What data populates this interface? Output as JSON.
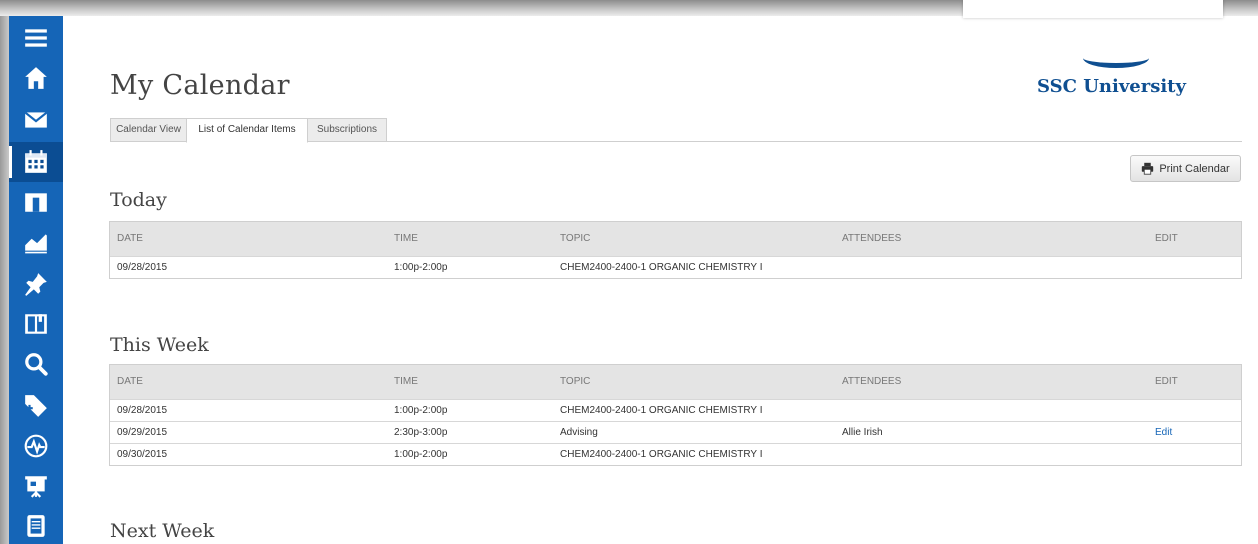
{
  "app": {
    "page_title": "My Calendar",
    "logo_text": "SSC University",
    "accent_color": "#1565b7"
  },
  "sidebar": {
    "items": [
      {
        "icon": "menu-icon",
        "active": false
      },
      {
        "icon": "home-icon",
        "active": false
      },
      {
        "icon": "mail-icon",
        "active": false
      },
      {
        "icon": "calendar-icon",
        "active": true
      },
      {
        "icon": "folder-icon",
        "active": false
      },
      {
        "icon": "chart-icon",
        "active": false
      },
      {
        "icon": "pin-icon",
        "active": false
      },
      {
        "icon": "book-icon",
        "active": false
      },
      {
        "icon": "search-icon",
        "active": false
      },
      {
        "icon": "tag-icon",
        "active": false
      },
      {
        "icon": "activity-icon",
        "active": false
      },
      {
        "icon": "presentation-icon",
        "active": false
      },
      {
        "icon": "document-icon",
        "active": false
      }
    ]
  },
  "tabs": [
    {
      "label": "Calendar View",
      "active": false
    },
    {
      "label": "List of Calendar Items",
      "active": true
    },
    {
      "label": "Subscriptions",
      "active": false
    }
  ],
  "toolbar": {
    "print_label": "Print Calendar"
  },
  "columns": {
    "date": "DATE",
    "time": "TIME",
    "topic": "TOPIC",
    "attendees": "ATTENDEES",
    "edit": "EDIT"
  },
  "sections": [
    {
      "title": "Today",
      "rows": [
        {
          "date": "09/28/2015",
          "time": "1:00p-2:00p",
          "topic": "CHEM2400-2400-1 ORGANIC CHEMISTRY I",
          "attendees": "",
          "edit": ""
        }
      ]
    },
    {
      "title": "This Week",
      "rows": [
        {
          "date": "09/28/2015",
          "time": "1:00p-2:00p",
          "topic": "CHEM2400-2400-1 ORGANIC CHEMISTRY I",
          "attendees": "",
          "edit": ""
        },
        {
          "date": "09/29/2015",
          "time": "2:30p-3:00p",
          "topic": "Advising",
          "attendees": "Allie Irish",
          "edit": "Edit"
        },
        {
          "date": "09/30/2015",
          "time": "1:00p-2:00p",
          "topic": "CHEM2400-2400-1 ORGANIC CHEMISTRY I",
          "attendees": "",
          "edit": ""
        }
      ]
    },
    {
      "title": "Next Week",
      "rows": []
    }
  ]
}
